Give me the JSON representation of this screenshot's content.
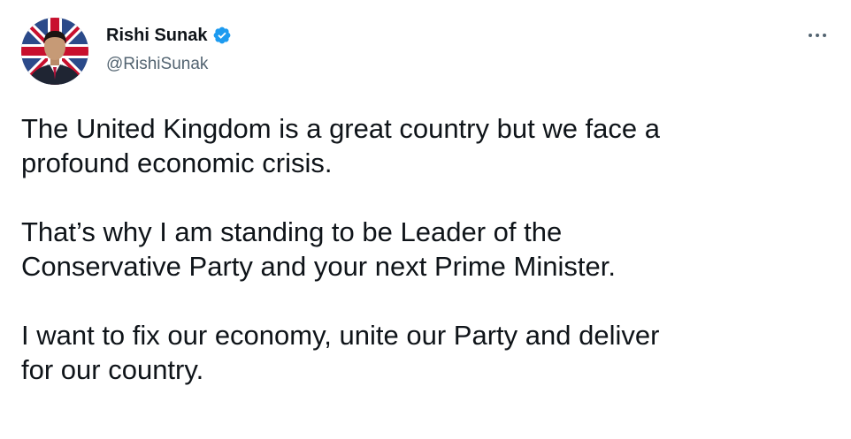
{
  "author": {
    "display_name": "Rishi Sunak",
    "handle": "@RishiSunak",
    "verified": true,
    "avatar": "profile-photo"
  },
  "menu_icon": "more-horizontal-icon",
  "tweet": {
    "paragraphs": [
      "The United Kingdom is a great country but we face a\nprofound economic crisis.",
      "That’s why I am standing to be Leader of the\nConservative Party and your next Prime Minister.",
      "I want to fix our economy, unite our Party and deliver\nfor our country."
    ]
  },
  "colors": {
    "verified_blue": "#1d9bf0",
    "handle_gray": "#536471",
    "text": "#0f1419"
  }
}
